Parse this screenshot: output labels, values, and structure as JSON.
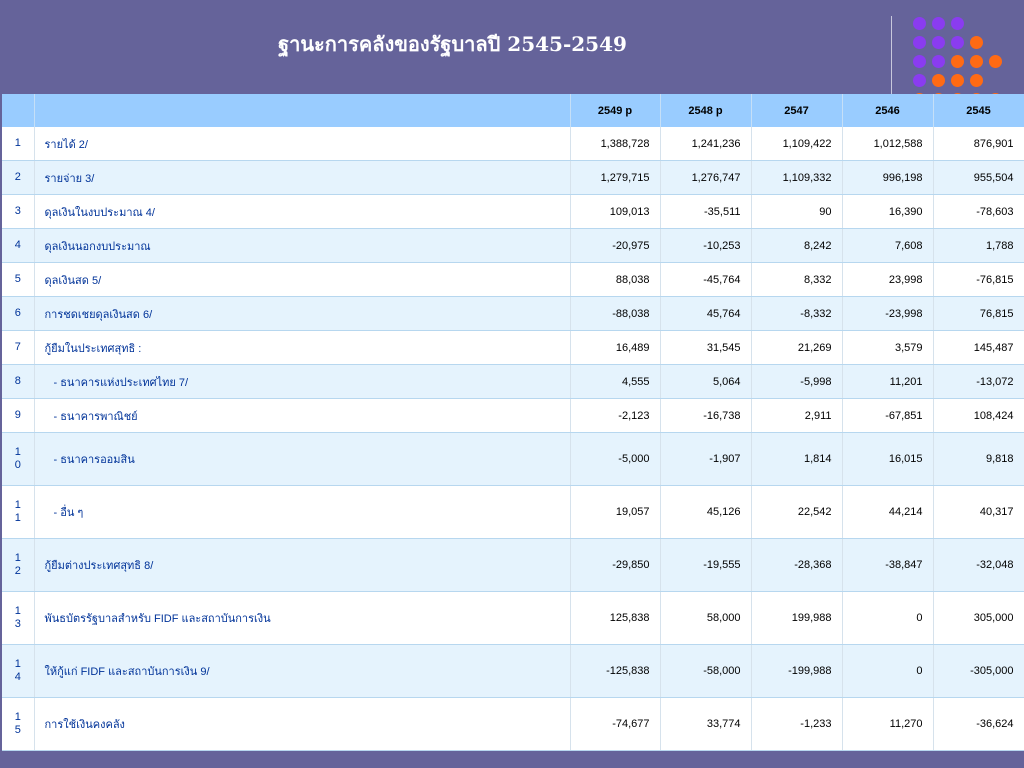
{
  "title": "ฐานะการคลังของรัฐบาลปี 2545-2549",
  "colors": {
    "background": "#65639a",
    "header": "#99ccff",
    "row_alt": "#e5f3fd",
    "label": "#003399"
  },
  "table": {
    "headers": [
      "",
      "",
      "2549 p",
      "2548 p",
      "2547",
      "2546",
      "2545"
    ],
    "rows": [
      {
        "idx": "1",
        "label": "รายได้ 2/",
        "values": [
          "1,388,728",
          "1,241,236",
          "1,109,422",
          "1,012,588",
          "876,901"
        ]
      },
      {
        "idx": "2",
        "label": "รายจ่าย 3/",
        "values": [
          "1,279,715",
          "1,276,747",
          "1,109,332",
          "996,198",
          "955,504"
        ]
      },
      {
        "idx": "3",
        "label": "ดุลเงินในงบประมาณ 4/",
        "values": [
          "109,013",
          "-35,511",
          "90",
          "16,390",
          "-78,603"
        ]
      },
      {
        "idx": "4",
        "label": "ดุลเงินนอกงบประมาณ",
        "values": [
          "-20,975",
          "-10,253",
          "8,242",
          "7,608",
          "1,788"
        ]
      },
      {
        "idx": "5",
        "label": "ดุลเงินสด 5/",
        "values": [
          "88,038",
          "-45,764",
          "8,332",
          "23,998",
          "-76,815"
        ]
      },
      {
        "idx": "6",
        "label": "การชดเชยดุลเงินสด 6/",
        "values": [
          "-88,038",
          "45,764",
          "-8,332",
          "-23,998",
          "76,815"
        ]
      },
      {
        "idx": "7",
        "label": "กู้ยืมในประเทศสุทธิ :",
        "values": [
          "16,489",
          "31,545",
          "21,269",
          "3,579",
          "145,487"
        ]
      },
      {
        "idx": "8",
        "label": "- ธนาคารแห่งประเทศไทย 7/",
        "values": [
          "4,555",
          "5,064",
          "-5,998",
          "11,201",
          "-13,072"
        ]
      },
      {
        "idx": "9",
        "label": "- ธนาคารพาณิชย์",
        "values": [
          "-2,123",
          "-16,738",
          "2,911",
          "-67,851",
          "108,424"
        ]
      },
      {
        "idx": "1\n0",
        "label": "- ธนาคารออมสิน",
        "values": [
          "-5,000",
          "-1,907",
          "1,814",
          "16,015",
          "9,818"
        ]
      },
      {
        "idx": "1\n1",
        "label": "- อื่น ๆ",
        "values": [
          "19,057",
          "45,126",
          "22,542",
          "44,214",
          "40,317"
        ]
      },
      {
        "idx": "1\n2",
        "label": "กู้ยืมต่างประเทศสุทธิ 8/",
        "values": [
          "-29,850",
          "-19,555",
          "-28,368",
          "-38,847",
          "-32,048"
        ]
      },
      {
        "idx": "1\n3",
        "label": "พันธบัตรรัฐบาลสำหรับ FIDF และสถาบันการเงิน",
        "values": [
          "125,838",
          "58,000",
          "199,988",
          "0",
          "305,000"
        ]
      },
      {
        "idx": "1\n4",
        "label": "ให้กู้แก่ FIDF และสถาบันการเงิน 9/",
        "values": [
          "-125,838",
          "-58,000",
          "-199,988",
          "0",
          "-305,000"
        ]
      },
      {
        "idx": "1\n5",
        "label": "การใช้เงินคงคลัง",
        "values": [
          "-74,677",
          "33,774",
          "-1,233",
          "11,270",
          "-36,624"
        ]
      }
    ]
  }
}
